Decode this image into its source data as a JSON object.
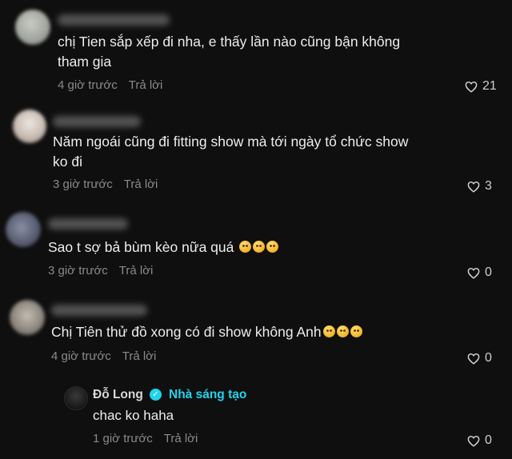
{
  "colors": {
    "accent": "#20d5ec",
    "background": "#0f0f0f",
    "meta": "#8a8a8a"
  },
  "comments": [
    {
      "text_lines": [
        "chị Tien sắp xếp đi nha, e thấy lần nào cũng bận không",
        "tham gia"
      ],
      "time": "4 giờ trước",
      "reply_label": "Trả lời",
      "likes": "21"
    },
    {
      "text_lines": [
        "Năm ngoái cũng đi fitting show mà tới ngày tổ chức show",
        "ko đi"
      ],
      "time": "3 giờ trước",
      "reply_label": "Trả lời",
      "likes": "3"
    },
    {
      "text_lines": [
        "Sao t sợ bả bùm kèo nữa quá"
      ],
      "time": "3 giờ trước",
      "reply_label": "Trả lời",
      "likes": "0"
    },
    {
      "text_lines": [
        "Chị Tiên thử đồ xong có đi show không Anh"
      ],
      "time": "4 giờ trước",
      "reply_label": "Trả lời",
      "likes": "0"
    }
  ],
  "reply": {
    "author": "Đỗ Long",
    "verified_icon": "verified-check-icon",
    "creator_label": "Nhà sáng tạo",
    "text": "chac ko haha",
    "time": "1 giờ trước",
    "reply_label": "Trả lời",
    "likes": "0"
  }
}
